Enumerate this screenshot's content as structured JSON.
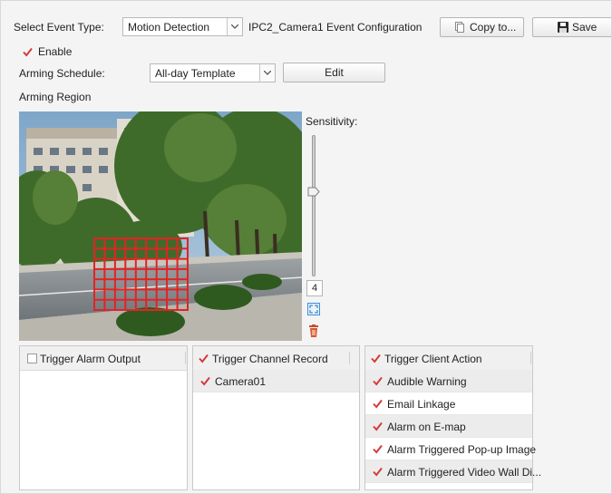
{
  "header": {
    "event_type_label": "Select Event Type:",
    "event_type_value": "Motion Detection",
    "config_title": "IPC2_Camera1 Event Configuration",
    "copy_label": "Copy to...",
    "save_label": "Save"
  },
  "enable": {
    "label": "Enable",
    "checked": true
  },
  "schedule": {
    "label": "Arming Schedule:",
    "value": "All-day Template",
    "edit_label": "Edit"
  },
  "region": {
    "label": "Arming Region"
  },
  "sensitivity": {
    "label": "Sensitivity:",
    "value": "4",
    "level": 4,
    "max": 6
  },
  "panels": {
    "alarm_output": {
      "header": "Trigger Alarm Output",
      "checked": false,
      "items": []
    },
    "channel_record": {
      "header": "Trigger Channel Record",
      "checked": true,
      "items": [
        {
          "label": "Camera01",
          "checked": true
        }
      ]
    },
    "client_action": {
      "header": "Trigger Client Action",
      "checked": true,
      "items": [
        {
          "label": "Audible Warning",
          "checked": true
        },
        {
          "label": "Email Linkage",
          "checked": true
        },
        {
          "label": "Alarm on E-map",
          "checked": true
        },
        {
          "label": "Alarm Triggered Pop-up Image",
          "checked": true
        },
        {
          "label": "Alarm Triggered Video Wall Di...",
          "checked": true
        }
      ]
    }
  },
  "colors": {
    "accent_red": "#d33a3a",
    "grid_red": "#e02424",
    "icon_blue": "#3f8ed6"
  }
}
